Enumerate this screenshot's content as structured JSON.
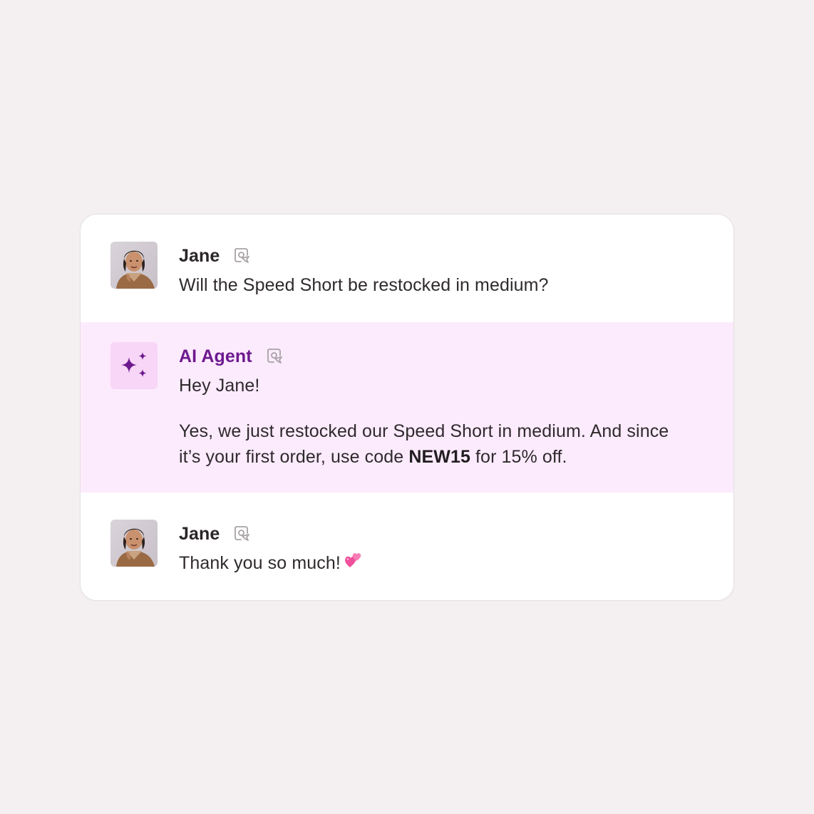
{
  "messages": [
    {
      "sender": "Jane",
      "role": "customer",
      "avatar": "customer-photo",
      "channel_icon": "chat-bubble-icon",
      "text": "Will the Speed Short be restocked in medium?"
    },
    {
      "sender": "AI Agent",
      "role": "agent",
      "avatar": "sparkles-icon",
      "channel_icon": "chat-bubble-icon",
      "greeting": "Hey Jane!",
      "body_before_code": "Yes, we just restocked our Speed Short in medium. And since it’s your first order, use code ",
      "code": "NEW15",
      "body_after_code": " for 15% off."
    },
    {
      "sender": "Jane",
      "role": "customer",
      "avatar": "customer-photo",
      "channel_icon": "chat-bubble-icon",
      "text": "Thank you so much!",
      "emoji": "two-hearts-emoji"
    }
  ],
  "colors": {
    "page_background": "#f4f0f1",
    "card_background": "#ffffff",
    "agent_highlight": "#fcebfd",
    "agent_accent": "#6d1a8f",
    "text": "#2f2a2d"
  }
}
